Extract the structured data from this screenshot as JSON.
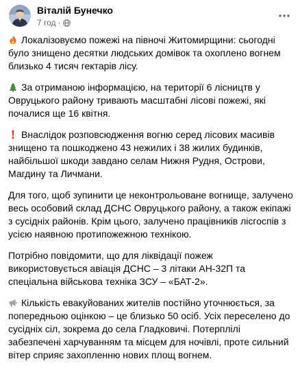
{
  "post": {
    "author": "Віталій Бунечко",
    "time": "7 год",
    "separator": "·",
    "paragraphs": [
      {
        "icon": "fire-emoji-icon",
        "text": "Локалізовуємо пожежі на півночі Житомирщини: сьогодні було знищено десятки людських домівок та охоплено вогнем близько 4 тисяч гектарів лісу."
      },
      {
        "icon": "evergreen-tree-emoji-icon",
        "text": "За отриманою інформацією, на території 6 лісництв у Овруцького району тривають масштабні лісові пожежі, які почалися ще 16 квітня."
      },
      {
        "icon": "exclamation-emoji-icon",
        "text": "Внаслідок розповсюдження вогню серед лісових масивів знищено та пошкоджено 43 нежилих і 38 жилих будинків, найбільшої шкоди завдано селам Нижня Рудня, Острови, Магдину та Личмани."
      },
      {
        "icon": "",
        "text": "Для того, щоб зупинити це неконтрольоване вогнище, залучено весь особовий склад ДСНС Овруцького району, а також екіпажі з сусідніх районів. Крім цього, залучено працівників лісгоспів з усією наявною протипожежною технікою."
      },
      {
        "icon": "",
        "text": "Потрібно повідомити, що для ліквідації пожеж використовується авіація ДСНС – 3 літаки АН-32П та спеціальна військова техніка ЗСУ – «БАТ-2»."
      },
      {
        "icon": "megaphone-emoji-icon",
        "text": "Кількість евакуйованих жителів постійно уточнюється, за попередньою оцінкою – це близько 50 осіб. Усіх переселено до сусідніх сіл, зокрема до села Гладковичі. Потерплілі забезпечені харчуванням та місцем для ночівлі, проте сильний вітер сприяє захопленню нових площ вогнем."
      }
    ]
  }
}
